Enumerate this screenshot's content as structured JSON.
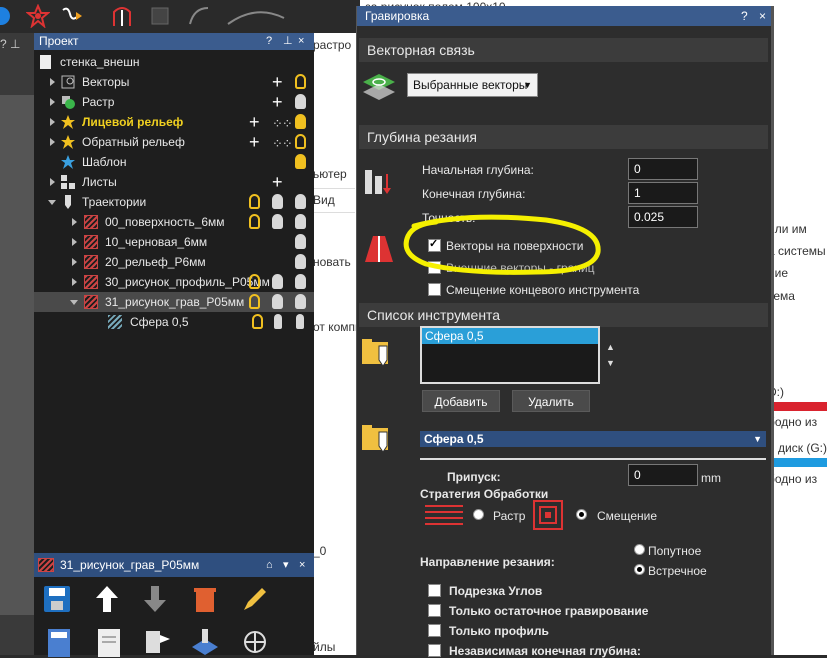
{
  "background": {
    "texts": [
      "дичь, т.к. за рисунок полем 100x10",
      "растро",
      "ьютер",
      "Вид",
      "новать",
      "или им",
      "а системы",
      "ние",
      "тема",
      "от компь",
      "D:)",
      "бодно из",
      "й диск (G:)",
      "бодно из",
      "_0",
      "йлы"
    ],
    "accent_red": "#d9232e",
    "accent_blue": "#1e9be0"
  },
  "project_panel": {
    "title": "Проект",
    "controls": [
      "?",
      "⊥",
      "×"
    ],
    "items": [
      {
        "label": "стенка_внешн",
        "highlight": false
      },
      {
        "label": "Векторы",
        "highlight": false
      },
      {
        "label": "Растр",
        "highlight": false
      },
      {
        "label": "Лицевой рельеф",
        "highlight": true
      },
      {
        "label": "Обратный рельеф",
        "highlight": false
      },
      {
        "label": "Шаблон",
        "highlight": false
      },
      {
        "label": "Листы",
        "highlight": false
      },
      {
        "label": "Траектории",
        "highlight": false
      },
      {
        "label": "00_поверхность_6мм",
        "highlight": false
      },
      {
        "label": "10_черновая_6мм",
        "highlight": false
      },
      {
        "label": "20_рельеф_Р6мм",
        "highlight": false
      },
      {
        "label": "30_рисунок_профиль_Р05мм",
        "highlight": false
      },
      {
        "label": "31_рисунок_грав_Р05мм",
        "highlight": false
      },
      {
        "label": "Сфера 0,5",
        "highlight": false
      }
    ]
  },
  "bottom_panel": {
    "title": "31_рисунок_грав_Р05мм",
    "controls": [
      "⌂",
      "▾",
      "×"
    ]
  },
  "dialog": {
    "title": "Гравировка",
    "controls": [
      "?",
      "×"
    ],
    "vector_section": "Векторная связь",
    "vector_select": "Выбранные векторы",
    "depth_section": "Глубина резания",
    "start_depth_label": "Начальная глубина:",
    "start_depth_value": "0",
    "end_depth_label": "Конечная глубина:",
    "end_depth_value": "1",
    "tolerance_label": "Точность:",
    "tolerance_value": "0.025",
    "chk_surface": "Векторы на поверхности",
    "chk_external": "Внешние векторы - границ",
    "chk_offset": "Смещение концевого инструмента",
    "tool_section": "Список инструмента",
    "tool_list": [
      "Сфера 0,5"
    ],
    "add_button": "Добавить",
    "remove_button": "Удалить",
    "tool_select": "Сфера 0,5",
    "allowance_label": "Припуск:",
    "allowance_value": "0",
    "allowance_unit": "mm",
    "strategy_label": "Стратегия Обработки",
    "strategy_raster": "Растр",
    "strategy_offset": "Смещение",
    "direction_label": "Направление резания:",
    "dir_climb": "Попутное",
    "dir_conv": "Встречное",
    "opt_corners": "Подрезка Углов",
    "opt_rest": "Только остаточное гравирование",
    "opt_profile": "Только профиль",
    "opt_indep": "Независимая конечная глубина:"
  },
  "annotation_color": "#f5f000"
}
